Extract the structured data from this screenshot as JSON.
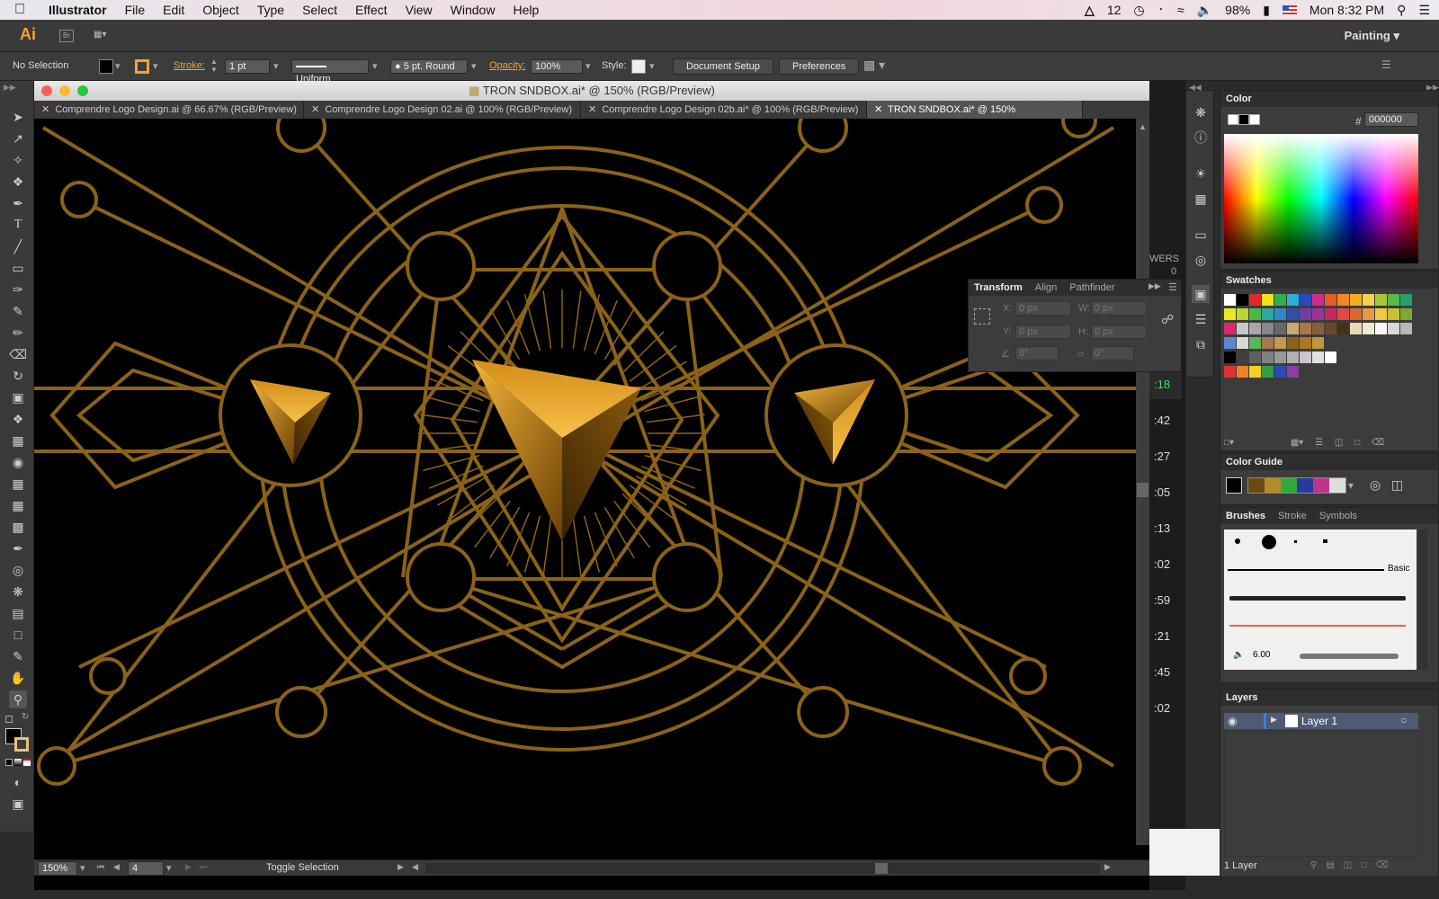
{
  "menubar": {
    "app": "Illustrator",
    "items": [
      "File",
      "Edit",
      "Object",
      "Type",
      "Select",
      "Effect",
      "View",
      "Window",
      "Help"
    ],
    "status": {
      "adobe_count": "12",
      "battery": "98%",
      "clock": "Mon 8:32 PM"
    }
  },
  "appbar": {
    "logo": "Ai",
    "bridge": "Br",
    "workspace": "Painting"
  },
  "controlbar": {
    "selection": "No Selection",
    "stroke_label": "Stroke:",
    "stroke_value": "1 pt",
    "profile": "Uniform",
    "brush": "5 pt. Round",
    "opacity_label": "Opacity:",
    "opacity_value": "100%",
    "style_label": "Style:",
    "document_setup": "Document Setup",
    "preferences": "Preferences"
  },
  "document": {
    "window_title": "TRON SNDBOX.ai* @ 150% (RGB/Preview)",
    "tabs": [
      "Comprendre Logo Design.ai @ 66.67% (RGB/Preview)",
      "Comprendre Logo Design 02.ai @ 100% (RGB/Preview)",
      "Comprendre Logo Design 02b.ai* @ 100% (RGB/Preview)",
      "TRON SNDBOX.ai* @ 150% (RGB/Preview)"
    ],
    "active_tab": 3
  },
  "statusbar": {
    "zoom": "150%",
    "artboard": "4",
    "status_text": "Toggle Selection"
  },
  "background_window": {
    "partial_label": "WERS",
    "partial_count": "0",
    "timestamps": [
      ":18",
      ":42",
      ":27",
      ":05",
      ":13",
      ":02",
      ":59",
      ":21",
      ":45",
      ":02"
    ],
    "highlight_color": "#3ddc6a"
  },
  "transform_panel": {
    "tabs": [
      "Transform",
      "Align",
      "Pathfinder"
    ],
    "x_label": "X:",
    "x_value": "0 px",
    "y_label": "Y:",
    "y_value": "0 px",
    "w_label": "W:",
    "w_value": "0 px",
    "h_label": "H:",
    "h_value": "0 px",
    "rotate_value": "0°",
    "shear_value": "0°"
  },
  "color_panel": {
    "title": "Color",
    "hex_label": "#",
    "hex_value": "000000"
  },
  "swatches_panel": {
    "title": "Swatches"
  },
  "color_guide_panel": {
    "title": "Color Guide"
  },
  "brushes_panel": {
    "tabs": [
      "Brushes",
      "Stroke",
      "Symbols"
    ],
    "basic_label": "Basic",
    "size_value": "6.00"
  },
  "layers_panel": {
    "title": "Layers",
    "layer_name": "Layer 1",
    "footer": "1 Layer"
  },
  "colors": {
    "gold": "#8a6318",
    "accent": "#f6a235",
    "canvas": "#000000"
  }
}
